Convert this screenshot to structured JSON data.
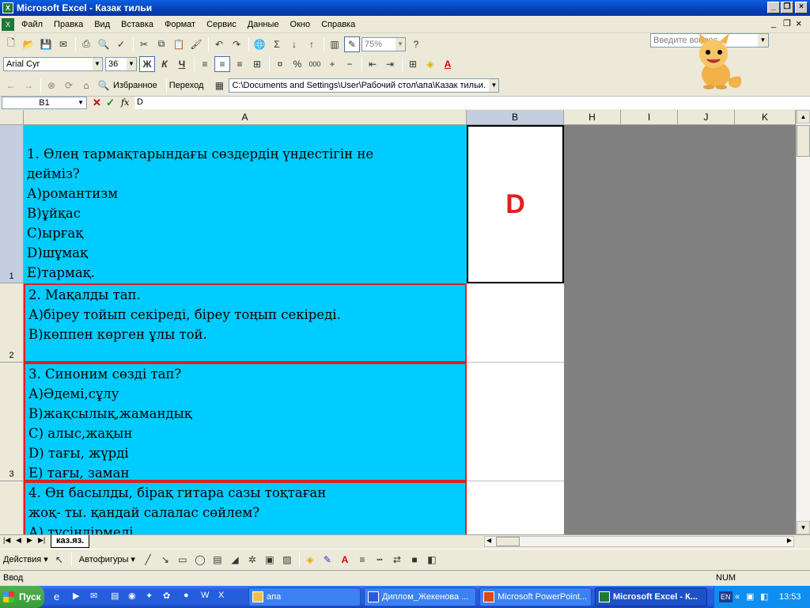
{
  "window": {
    "title": "Microsoft Excel - Казак тильи",
    "icon": "excel-icon"
  },
  "menu": {
    "items": [
      "Файл",
      "Правка",
      "Вид",
      "Вставка",
      "Формат",
      "Сервис",
      "Данные",
      "Окно",
      "Справка"
    ],
    "ask_placeholder": "Введите вопрос"
  },
  "toolbar": {
    "zoom": "75%",
    "font": "Arial Cyr",
    "font_size": "36",
    "bold": "Ж",
    "italic": "К",
    "underline": "Ч",
    "web_buttons": {
      "favorites": "Избранное",
      "goto": "Переход"
    },
    "address": "C:\\Documents and Settings\\User\\Рабочий стол\\апа\\Казак тильи."
  },
  "formula_bar": {
    "name_box": "B1",
    "fx": "fx",
    "value": "D"
  },
  "columns": [
    "A",
    "B",
    "H",
    "I",
    "J",
    "K"
  ],
  "rows": [
    {
      "num": "1",
      "lines": [
        "1. Өлең  тармақтарындағы  сөздердің  үндестігін  не",
        "дейміз?",
        "А)романтизм",
        "В)ұйқас",
        "С)ырғақ",
        "D)шұмақ",
        "Е)тармақ."
      ],
      "b": "D"
    },
    {
      "num": "2",
      "lines": [
        "2.  Мақалды   тап.",
        "А)біреу   тойып   секіреді, біреу тоңып   секіреді.",
        "В)көппен   көрген   ұлы   той."
      ],
      "b": ""
    },
    {
      "num": "3",
      "lines": [
        "3.  Синоним   сөзді   тап?",
        "А)Әдемі,сұлу",
        "В)жақсылық,жамандық",
        "С)    алыс,жақын",
        "D)    тағы,  жүрді",
        "Е)    тағы,  заман"
      ],
      "b": ""
    },
    {
      "num": "",
      "lines": [
        "4.  Өн   басылды, бірақ   гитара   сазы   тоқтаған",
        "   жоқ- ты. қандай   салалас   сөйлем?",
        "А)    түсіндірмелі"
      ],
      "b": ""
    }
  ],
  "sheet_tab": "каз.яз.",
  "draw_toolbar": {
    "actions": "Действия",
    "autoshapes": "Автофигуры"
  },
  "status": {
    "mode": "Ввод",
    "num": "NUM"
  },
  "taskbar": {
    "start": "Пуск",
    "tasks": [
      "апа",
      "Диплом_Жекенова ...",
      "Microsoft PowerPoint...",
      "Microsoft Excel - К..."
    ],
    "lang": "EN",
    "time": "13:53"
  }
}
